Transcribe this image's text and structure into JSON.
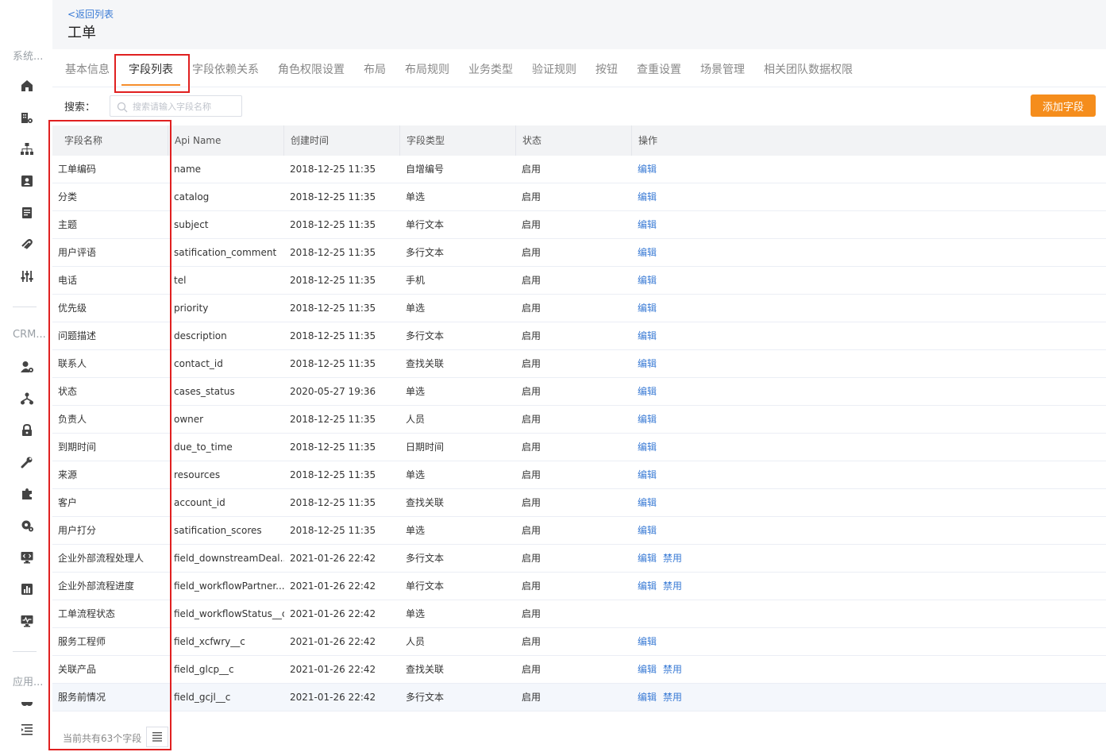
{
  "rail": {
    "group_system": "系统...",
    "group_crm": "CRM...",
    "group_app": "应用...",
    "icons": [
      "home-icon",
      "building-settings-icon",
      "org-chart-icon",
      "contact-card-icon",
      "document-icon",
      "link-icon",
      "sliders-icon",
      "user-settings-icon",
      "hierarchy-icon",
      "lock-icon",
      "wrench-icon",
      "puzzle-icon",
      "gear-user-icon",
      "code-monitor-icon",
      "bar-chart-icon",
      "pulse-monitor-icon",
      "group-icon",
      "collapse-menu-icon"
    ]
  },
  "header": {
    "back_label": "<返回列表",
    "title": "工单"
  },
  "tabs": [
    {
      "label": "基本信息"
    },
    {
      "label": "字段列表"
    },
    {
      "label": "字段依赖关系"
    },
    {
      "label": "角色权限设置"
    },
    {
      "label": "布局"
    },
    {
      "label": "布局规则"
    },
    {
      "label": "业务类型"
    },
    {
      "label": "验证规则"
    },
    {
      "label": "按钮"
    },
    {
      "label": "查重设置"
    },
    {
      "label": "场景管理"
    },
    {
      "label": "相关团队数据权限"
    }
  ],
  "active_tab": "字段列表",
  "search": {
    "label": "搜索：",
    "placeholder": "搜索请输入字段名称"
  },
  "add_button": "添加字段",
  "table": {
    "headers": [
      "字段名称",
      "Api Name",
      "创建时间",
      "字段类型",
      "状态",
      "操作"
    ],
    "rows": [
      {
        "name": "工单编码",
        "api": "name",
        "created": "2018-12-25 11:35",
        "type": "自增编号",
        "status": "启用",
        "ops": [
          "编辑"
        ]
      },
      {
        "name": "分类",
        "api": "catalog",
        "created": "2018-12-25 11:35",
        "type": "单选",
        "status": "启用",
        "ops": [
          "编辑"
        ]
      },
      {
        "name": "主题",
        "api": "subject",
        "created": "2018-12-25 11:35",
        "type": "单行文本",
        "status": "启用",
        "ops": [
          "编辑"
        ]
      },
      {
        "name": "用户评语",
        "api": "satification_comment",
        "created": "2018-12-25 11:35",
        "type": "多行文本",
        "status": "启用",
        "ops": [
          "编辑"
        ]
      },
      {
        "name": "电话",
        "api": "tel",
        "created": "2018-12-25 11:35",
        "type": "手机",
        "status": "启用",
        "ops": [
          "编辑"
        ]
      },
      {
        "name": "优先级",
        "api": "priority",
        "created": "2018-12-25 11:35",
        "type": "单选",
        "status": "启用",
        "ops": [
          "编辑"
        ]
      },
      {
        "name": "问题描述",
        "api": "description",
        "created": "2018-12-25 11:35",
        "type": "多行文本",
        "status": "启用",
        "ops": [
          "编辑"
        ]
      },
      {
        "name": "联系人",
        "api": "contact_id",
        "created": "2018-12-25 11:35",
        "type": "查找关联",
        "status": "启用",
        "ops": [
          "编辑"
        ]
      },
      {
        "name": "状态",
        "api": "cases_status",
        "created": "2020-05-27 19:36",
        "type": "单选",
        "status": "启用",
        "ops": [
          "编辑"
        ]
      },
      {
        "name": "负责人",
        "api": "owner",
        "created": "2018-12-25 11:35",
        "type": "人员",
        "status": "启用",
        "ops": [
          "编辑"
        ]
      },
      {
        "name": "到期时间",
        "api": "due_to_time",
        "created": "2018-12-25 11:35",
        "type": "日期时间",
        "status": "启用",
        "ops": [
          "编辑"
        ]
      },
      {
        "name": "来源",
        "api": "resources",
        "created": "2018-12-25 11:35",
        "type": "单选",
        "status": "启用",
        "ops": [
          "编辑"
        ]
      },
      {
        "name": "客户",
        "api": "account_id",
        "created": "2018-12-25 11:35",
        "type": "查找关联",
        "status": "启用",
        "ops": [
          "编辑"
        ]
      },
      {
        "name": "用户打分",
        "api": "satification_scores",
        "created": "2018-12-25 11:35",
        "type": "单选",
        "status": "启用",
        "ops": [
          "编辑"
        ]
      },
      {
        "name": "企业外部流程处理人",
        "api": "field_downstreamDeal...",
        "created": "2021-01-26 22:42",
        "type": "多行文本",
        "status": "启用",
        "ops": [
          "编辑",
          "禁用"
        ]
      },
      {
        "name": "企业外部流程进度",
        "api": "field_workflowPartner...",
        "created": "2021-01-26 22:42",
        "type": "单行文本",
        "status": "启用",
        "ops": [
          "编辑",
          "禁用"
        ]
      },
      {
        "name": "工单流程状态",
        "api": "field_workflowStatus__c",
        "created": "2021-01-26 22:42",
        "type": "单选",
        "status": "启用",
        "ops": []
      },
      {
        "name": "服务工程师",
        "api": "field_xcfwry__c",
        "created": "2021-01-26 22:42",
        "type": "人员",
        "status": "启用",
        "ops": [
          "编辑"
        ]
      },
      {
        "name": "关联产品",
        "api": "field_glcp__c",
        "created": "2021-01-26 22:42",
        "type": "查找关联",
        "status": "启用",
        "ops": [
          "编辑",
          "禁用"
        ]
      },
      {
        "name": "服务前情况",
        "api": "field_gcjl__c",
        "created": "2021-01-26 22:42",
        "type": "多行文本",
        "status": "启用",
        "ops": [
          "编辑",
          "禁用"
        ]
      }
    ]
  },
  "footer": {
    "count_text": "当前共有63个字段"
  },
  "colors": {
    "accent": "#f58d1c",
    "link": "#3a7bd5",
    "highlight_box": "#e02020"
  }
}
